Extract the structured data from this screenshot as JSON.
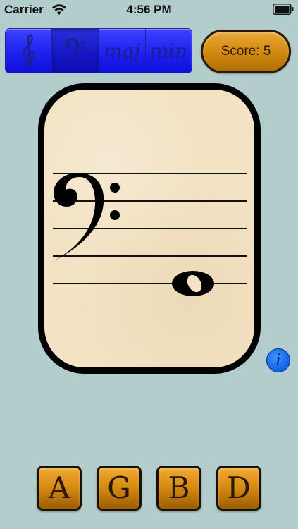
{
  "status_bar": {
    "carrier": "Carrier",
    "time": "4:56 PM",
    "wifi_icon": "wifi-icon",
    "battery_icon": "battery-full-icon"
  },
  "mode_selector": {
    "segments": [
      {
        "label": "",
        "icon": "treble-clef-icon",
        "selected": false
      },
      {
        "label": "",
        "icon": "bass-clef-icon",
        "selected": true
      },
      {
        "label": "maj",
        "icon": "",
        "selected": false
      },
      {
        "label": "min",
        "icon": "",
        "selected": false
      }
    ]
  },
  "score": {
    "label": "Score: 5"
  },
  "flashcard": {
    "clef": "bass-clef-icon",
    "note": "whole-note-icon"
  },
  "info_button": {
    "label": "i"
  },
  "answers": [
    {
      "label": "A"
    },
    {
      "label": "G"
    },
    {
      "label": "B"
    },
    {
      "label": "D"
    }
  ],
  "colors": {
    "background": "#b3cccc",
    "segment_blue": "#1d21f0",
    "button_orange": "#d98d12",
    "card_paper": "#f3e2c3"
  }
}
